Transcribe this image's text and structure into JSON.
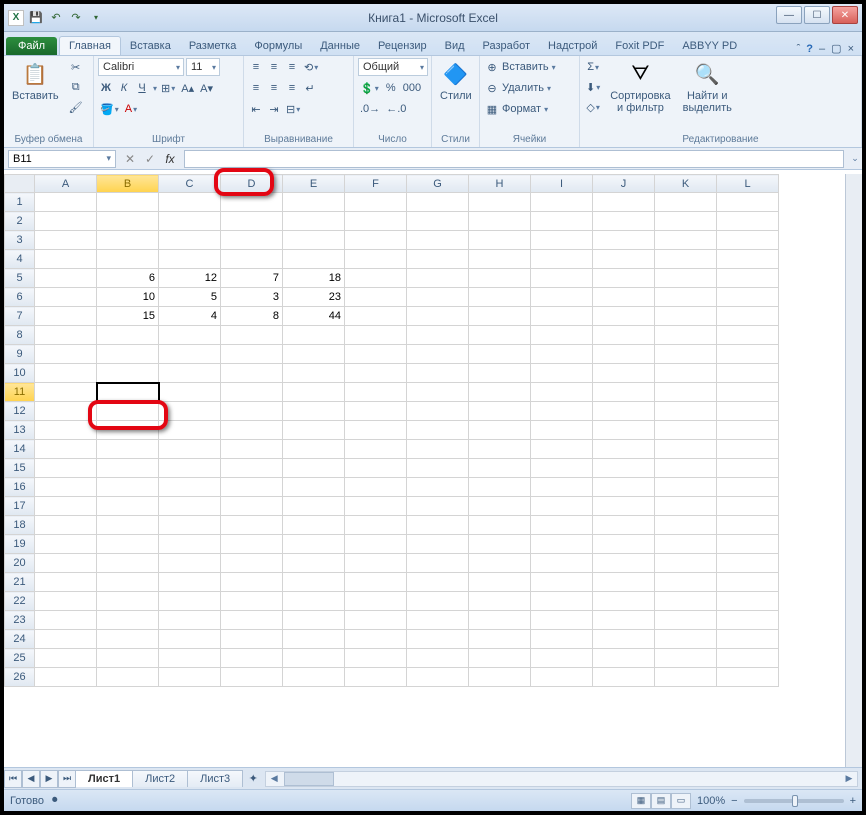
{
  "title": "Книга1 - Microsoft Excel",
  "tabs": {
    "file": "Файл",
    "home": "Главная",
    "insert": "Вставка",
    "layout": "Разметка",
    "formulas": "Формулы",
    "data": "Данные",
    "review": "Рецензир",
    "view": "Вид",
    "developer": "Разработ",
    "addins": "Надстрой",
    "foxit": "Foxit PDF",
    "abbyy": "ABBYY PD"
  },
  "ribbon": {
    "clipboard": {
      "paste": "Вставить",
      "label": "Буфер обмена"
    },
    "font": {
      "name": "Calibri",
      "size": "11",
      "bold": "Ж",
      "italic": "К",
      "underline": "Ч",
      "label": "Шрифт"
    },
    "alignment": {
      "label": "Выравнивание"
    },
    "number": {
      "format": "Общий",
      "label": "Число"
    },
    "styles": {
      "label": "Стили",
      "btn": "Стили"
    },
    "cells": {
      "insert": "Вставить",
      "delete": "Удалить",
      "format": "Формат",
      "label": "Ячейки"
    },
    "editing": {
      "sort": "Сортировка\nи фильтр",
      "find": "Найти и\nвыделить",
      "label": "Редактирование"
    }
  },
  "name_box": "B11",
  "fx": "fx",
  "columns": [
    "A",
    "B",
    "C",
    "D",
    "E",
    "F",
    "G",
    "H",
    "I",
    "J",
    "K",
    "L"
  ],
  "rows_count": 26,
  "selected_cell": {
    "row": 11,
    "col": "B"
  },
  "cell_data": {
    "5": {
      "B": "6",
      "C": "12",
      "D": "7",
      "E": "18"
    },
    "6": {
      "B": "10",
      "C": "5",
      "D": "3",
      "E": "23"
    },
    "7": {
      "B": "15",
      "C": "4",
      "D": "8",
      "E": "44"
    }
  },
  "sheet_tabs": [
    "Лист1",
    "Лист2",
    "Лист3"
  ],
  "active_sheet": 0,
  "status": "Готово",
  "zoom": "100%"
}
